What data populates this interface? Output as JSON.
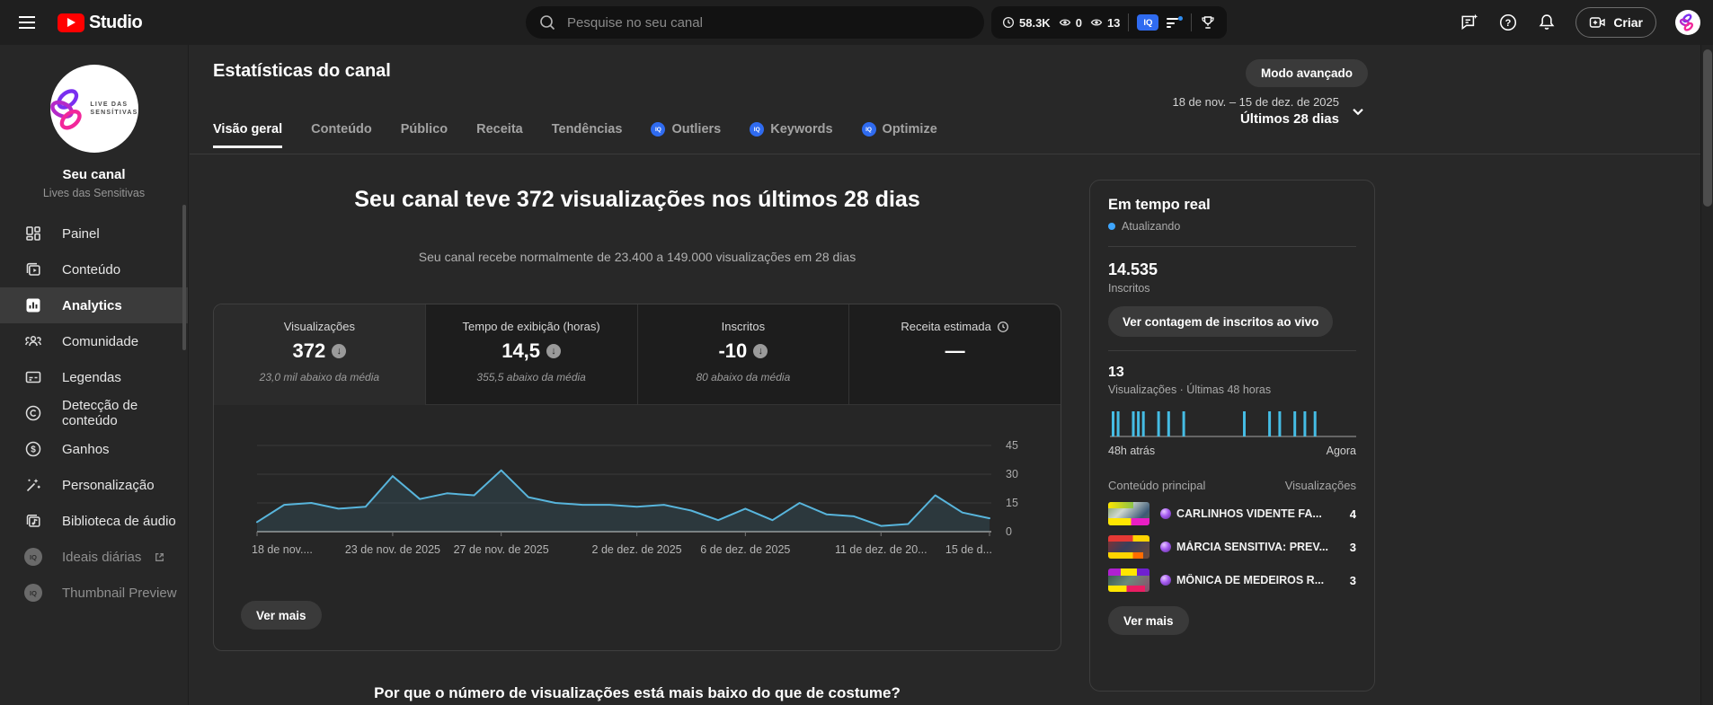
{
  "topbar": {
    "brand": "Studio",
    "search": {
      "placeholder": "Pesquise no seu canal"
    },
    "extension_stats": {
      "watch_time": "58.3K",
      "stat_a": "0",
      "stat_b": "13",
      "iq_badge": "IQ"
    },
    "create_label": "Criar"
  },
  "sidebar": {
    "avatar_text_line1": "LIVE DAS",
    "avatar_text_line2": "SENSÍTIVAS",
    "channel_title": "Seu canal",
    "channel_subtitle": "Lives das Sensitivas",
    "items": [
      {
        "label": "Painel"
      },
      {
        "label": "Conteúdo"
      },
      {
        "label": "Analytics"
      },
      {
        "label": "Comunidade"
      },
      {
        "label": "Legendas"
      },
      {
        "label": "Detecção de conteúdo"
      },
      {
        "label": "Ganhos"
      },
      {
        "label": "Personalização"
      },
      {
        "label": "Biblioteca de áudio"
      },
      {
        "label": "Ideais diárias"
      },
      {
        "label": "Thumbnail Preview"
      }
    ]
  },
  "header": {
    "title": "Estatísticas do canal",
    "advanced_mode_label": "Modo avançado",
    "date_range": "18 de nov. – 15 de dez. de 2025",
    "date_preset": "Últimos 28 dias",
    "tabs": [
      {
        "label": "Visão geral"
      },
      {
        "label": "Conteúdo"
      },
      {
        "label": "Público"
      },
      {
        "label": "Receita"
      },
      {
        "label": "Tendências"
      },
      {
        "label": "Outliers"
      },
      {
        "label": "Keywords"
      },
      {
        "label": "Optimize"
      }
    ]
  },
  "overview": {
    "headline": "Seu canal teve 372 visualizações nos últimos 28 dias",
    "subtitle": "Seu canal recebe normalmente de 23.400 a 149.000 visualizações em 28 dias",
    "metrics": [
      {
        "label": "Visualizações",
        "value": "372",
        "trend": "down",
        "note": "23,0 mil abaixo da média"
      },
      {
        "label": "Tempo de exibição (horas)",
        "value": "14,5",
        "trend": "down",
        "note": "355,5 abaixo da média"
      },
      {
        "label": "Inscritos",
        "value": "-10",
        "trend": "down",
        "note": "80 abaixo da média"
      },
      {
        "label": "Receita estimada",
        "value": "—",
        "trend": "none",
        "note": ""
      }
    ],
    "see_more_label": "Ver mais",
    "question": "Por que o número de visualizações está mais baixo do que de costume?"
  },
  "realtime": {
    "title": "Em tempo real",
    "status": "Atualizando",
    "subscribers_value": "14.535",
    "subscribers_label": "Inscritos",
    "live_count_button": "Ver contagem de inscritos ao vivo",
    "views_value": "13",
    "views_label": "Visualizações · Últimas 48 horas",
    "axis_start": "48h atrás",
    "axis_end": "Agora",
    "list_header_left": "Conteúdo principal",
    "list_header_right": "Visualizações",
    "videos": [
      {
        "title": "CARLINHOS VIDENTE FA...",
        "views": "4"
      },
      {
        "title": "MÁRCIA SENSITIVA: PREV...",
        "views": "3"
      },
      {
        "title": "MÔNICA DE MEDEIROS R...",
        "views": "3"
      }
    ],
    "see_more_label": "Ver mais"
  },
  "chart_data": [
    {
      "type": "area",
      "metric": "Visualizações",
      "x_start": "18 de nov. de 2025",
      "x_end": "15 de dez. de 2025",
      "values": [
        5,
        14,
        15,
        12,
        13,
        29,
        17,
        20,
        19,
        32,
        18,
        15,
        14,
        14,
        13,
        14,
        11,
        6,
        12,
        6,
        15,
        9,
        8,
        3,
        4,
        19,
        10,
        7
      ],
      "ylim": [
        0,
        48
      ],
      "yticks": [
        0,
        15,
        30,
        45
      ],
      "x_ticks": [
        {
          "day": 0,
          "label": "18 de nov...."
        },
        {
          "day": 5,
          "label": "23 de nov. de 2025"
        },
        {
          "day": 9,
          "label": "27 de nov. de 2025"
        },
        {
          "day": 14,
          "label": "2 de dez. de 2025"
        },
        {
          "day": 18,
          "label": "6 de dez. de 2025"
        },
        {
          "day": 23,
          "label": "11 de dez. de 20..."
        },
        {
          "day": 27,
          "label": "15 de d..."
        }
      ],
      "grid": true,
      "line_color": "#58b5dc"
    },
    {
      "type": "bar",
      "metric": "Visualizações · Últimas 48 horas",
      "slots": 48,
      "bar_slots": [
        0,
        1,
        4,
        5,
        6,
        9,
        11,
        14,
        26,
        31,
        33,
        36,
        38,
        40
      ],
      "bar_value": 1,
      "bar_color": "#45bce4",
      "xlabels": [
        "48h atrás",
        "Agora"
      ]
    }
  ],
  "colors": {
    "youtube_red": "#ff0000",
    "vidiq_blue": "#2f6bf0",
    "accent_blue": "#3ea6ff",
    "chart_line": "#58b5dc",
    "realtime_bar": "#45bce4"
  }
}
